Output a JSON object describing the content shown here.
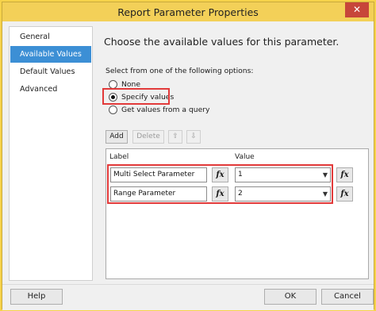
{
  "window": {
    "title": "Report Parameter Properties",
    "close_glyph": "✕"
  },
  "nav": {
    "items": [
      "General",
      "Available Values",
      "Default Values",
      "Advanced"
    ],
    "active_index": 1
  },
  "main": {
    "heading": "Choose the available values for this parameter.",
    "instruction": "Select from one of the following options:",
    "options": [
      {
        "label": "None",
        "checked": false
      },
      {
        "label": "Specify values",
        "checked": true
      },
      {
        "label": "Get values from a query",
        "checked": false
      }
    ]
  },
  "toolbar": {
    "add": "Add",
    "delete": "Delete",
    "up_glyph": "⇧",
    "down_glyph": "⇩"
  },
  "grid": {
    "col_label": "Label",
    "col_value": "Value",
    "rows": [
      {
        "label": "Multi Select Parameter",
        "value": "1"
      },
      {
        "label": "Range Parameter",
        "value": "2"
      }
    ],
    "fx_glyph": "fx",
    "dropdown_glyph": "▼"
  },
  "footer": {
    "help": "Help",
    "ok": "OK",
    "cancel": "Cancel"
  },
  "colors": {
    "highlight": "#e23a3a",
    "selection": "#3c8fd5",
    "titlebar": "#f3d058"
  }
}
